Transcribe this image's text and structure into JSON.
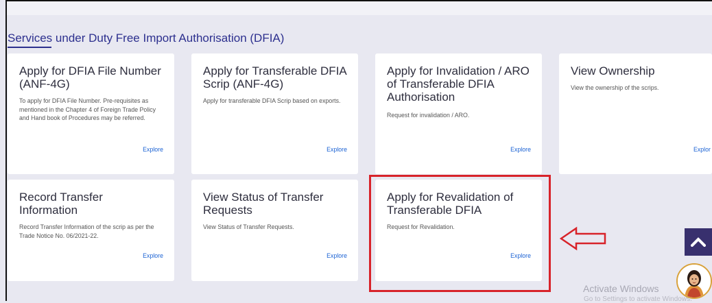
{
  "section": {
    "title": "Services under Duty Free Import Authorisation (DFIA)"
  },
  "cards": [
    {
      "title": "Apply for DFIA File Number (ANF-4G)",
      "desc": "To apply for DFIA File Number. Pre-requisites as mentioned in the Chapter 4 of Foreign Trade Policy and Hand book of Procedures may be referred.",
      "explore": "Explore"
    },
    {
      "title": "Apply for Transferable DFIA Scrip (ANF-4G)",
      "desc": "Apply for transferable DFIA Scrip based on exports.",
      "explore": "Explore"
    },
    {
      "title": "Apply for Invalidation / ARO of Transferable DFIA Authorisation",
      "desc": "Request for invalidation / ARO.",
      "explore": "Explore"
    },
    {
      "title": "View Ownership",
      "desc": "View the ownership of the scrips.",
      "explore": "Explor"
    },
    {
      "title": "Record Transfer Information",
      "desc": "Record Transfer Information of the scrip as per the Trade Notice No. 06/2021-22.",
      "explore": "Explore"
    },
    {
      "title": "View Status of Transfer Requests",
      "desc": "View Status of Transfer Requests.",
      "explore": "Explore"
    },
    {
      "title": "Apply for Revalidation of Transferable DFIA",
      "desc": "Request for Revalidation.",
      "explore": "Explore"
    }
  ],
  "watermark": {
    "line1": "Activate Windows",
    "line2": "Go to Settings to activate Windows."
  },
  "icons": {
    "scroll_top": "chevron-up-icon",
    "pointer": "arrow-left-icon",
    "avatar": "assistant-avatar-icon"
  },
  "colors": {
    "accent": "#2c2f8e",
    "link": "#1c63d4",
    "highlight": "#d8232a",
    "scroll_button": "#38306e"
  }
}
